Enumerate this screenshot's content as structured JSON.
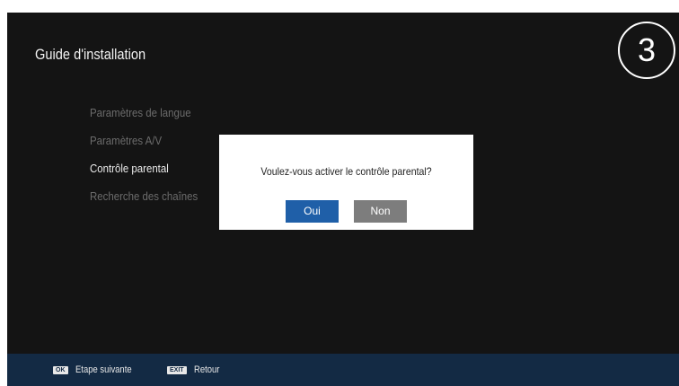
{
  "header": {
    "title": "Guide d'installation",
    "step_number": "3"
  },
  "menu": {
    "items": [
      {
        "label": "Paramètres de langue",
        "active": false
      },
      {
        "label": "Paramètres A/V",
        "active": false
      },
      {
        "label": "Contrôle parental",
        "active": true
      },
      {
        "label": "Recherche des chaînes",
        "active": false
      }
    ]
  },
  "dialog": {
    "message": "Voulez-vous activer le contrôle parental?",
    "yes_label": "Oui",
    "no_label": "Non"
  },
  "footer": {
    "ok_key": "OK",
    "ok_label": "Etape suivante",
    "exit_key": "EXIT",
    "exit_label": "Retour"
  },
  "colors": {
    "background": "#141414",
    "footer": "#132a44",
    "selected_button": "#1f5fa8",
    "unselected_button": "#7d7d7d"
  }
}
